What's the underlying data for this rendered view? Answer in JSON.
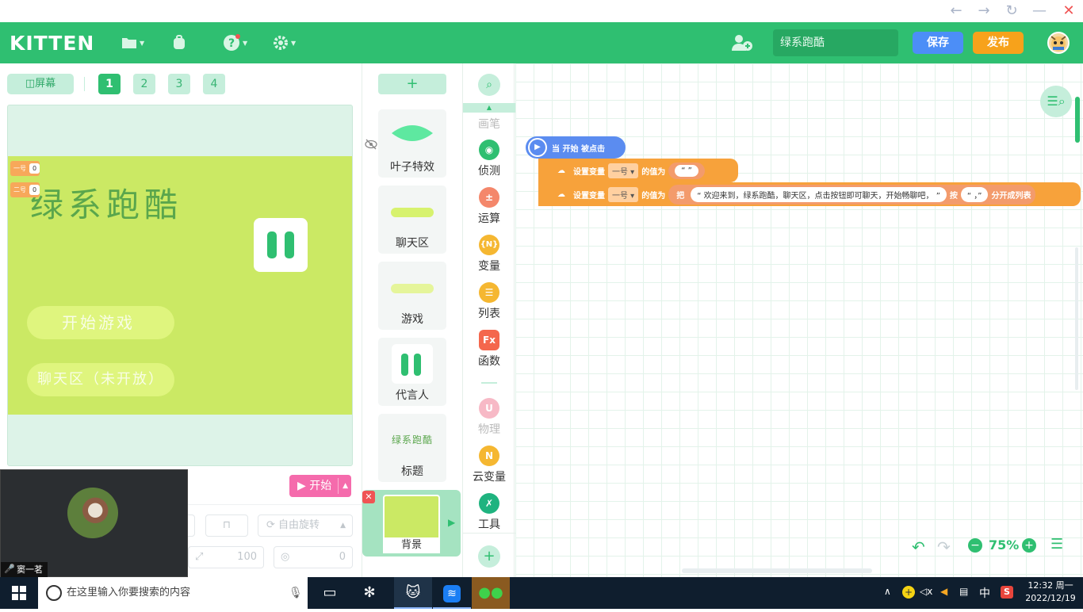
{
  "app": {
    "logo": "KITTEN",
    "project_name": "绿系跑酷",
    "save_label": "保存",
    "publish_label": "发布"
  },
  "stage": {
    "screen_button": "屏幕",
    "pages": [
      "1",
      "2",
      "3",
      "4"
    ],
    "active_page": "1",
    "title_text": "绿系跑酷",
    "start_game_button": "开始游戏",
    "chat_button": "聊天区（未开放）",
    "monitors": [
      {
        "label": "一号",
        "value": "0"
      },
      {
        "label": "二号",
        "value": "0"
      }
    ],
    "start_label": "开始",
    "rotation_label": "自由旋转",
    "size_value": "100",
    "direction_value": "0"
  },
  "webcam": {
    "name": "窦一茗"
  },
  "sprites": [
    {
      "label": "叶子特效"
    },
    {
      "label": "聊天区"
    },
    {
      "label": "游戏"
    },
    {
      "label": "代言人"
    },
    {
      "label": "标题",
      "thumb_text": "绿系跑酷"
    }
  ],
  "background": {
    "label": "背景"
  },
  "categories": [
    {
      "label": "画笔",
      "icon": "pen-icon",
      "color": "#cccccc"
    },
    {
      "label": "侦测",
      "icon": "sensor-icon",
      "color": "#2fbf71"
    },
    {
      "label": "运算",
      "icon": "operator-icon",
      "color": "#f4876b"
    },
    {
      "label": "变量",
      "icon": "variable-icon",
      "color": "#f5b731",
      "glyph": "{N}"
    },
    {
      "label": "列表",
      "icon": "list-icon",
      "color": "#f5b731"
    },
    {
      "label": "函数",
      "icon": "function-icon",
      "color": "#f4674d",
      "glyph": "Fx"
    },
    {
      "label": "物理",
      "icon": "magnet-icon",
      "color": "#f7b9c6",
      "glyph": "U"
    },
    {
      "label": "云变量",
      "icon": "cloud-variable-icon",
      "color": "#f5b731",
      "glyph": "N"
    },
    {
      "label": "工具",
      "icon": "tools-icon",
      "color": "#1fb37f"
    }
  ],
  "blocks": {
    "hat": "当 开始 被点击",
    "set1": {
      "prefix": "设置变量",
      "var": "一号",
      "mid": "的值为",
      "value": "“ ”"
    },
    "set2": {
      "prefix": "设置变量",
      "var": "一号",
      "mid": "的值为",
      "ba": "把",
      "text": "“ 欢迎来到，绿系跑酷，聊天区，点击按钮即可聊天，开始畅聊吧， ”",
      "an": "按",
      "sep": "“ ，”",
      "suffix": "分开成列表"
    }
  },
  "zoom": {
    "value": "75%"
  },
  "taskbar": {
    "search_placeholder": "在这里输入你要搜索的内容",
    "ime": "中",
    "time": "12:32 周一",
    "date": "2022/12/19"
  }
}
